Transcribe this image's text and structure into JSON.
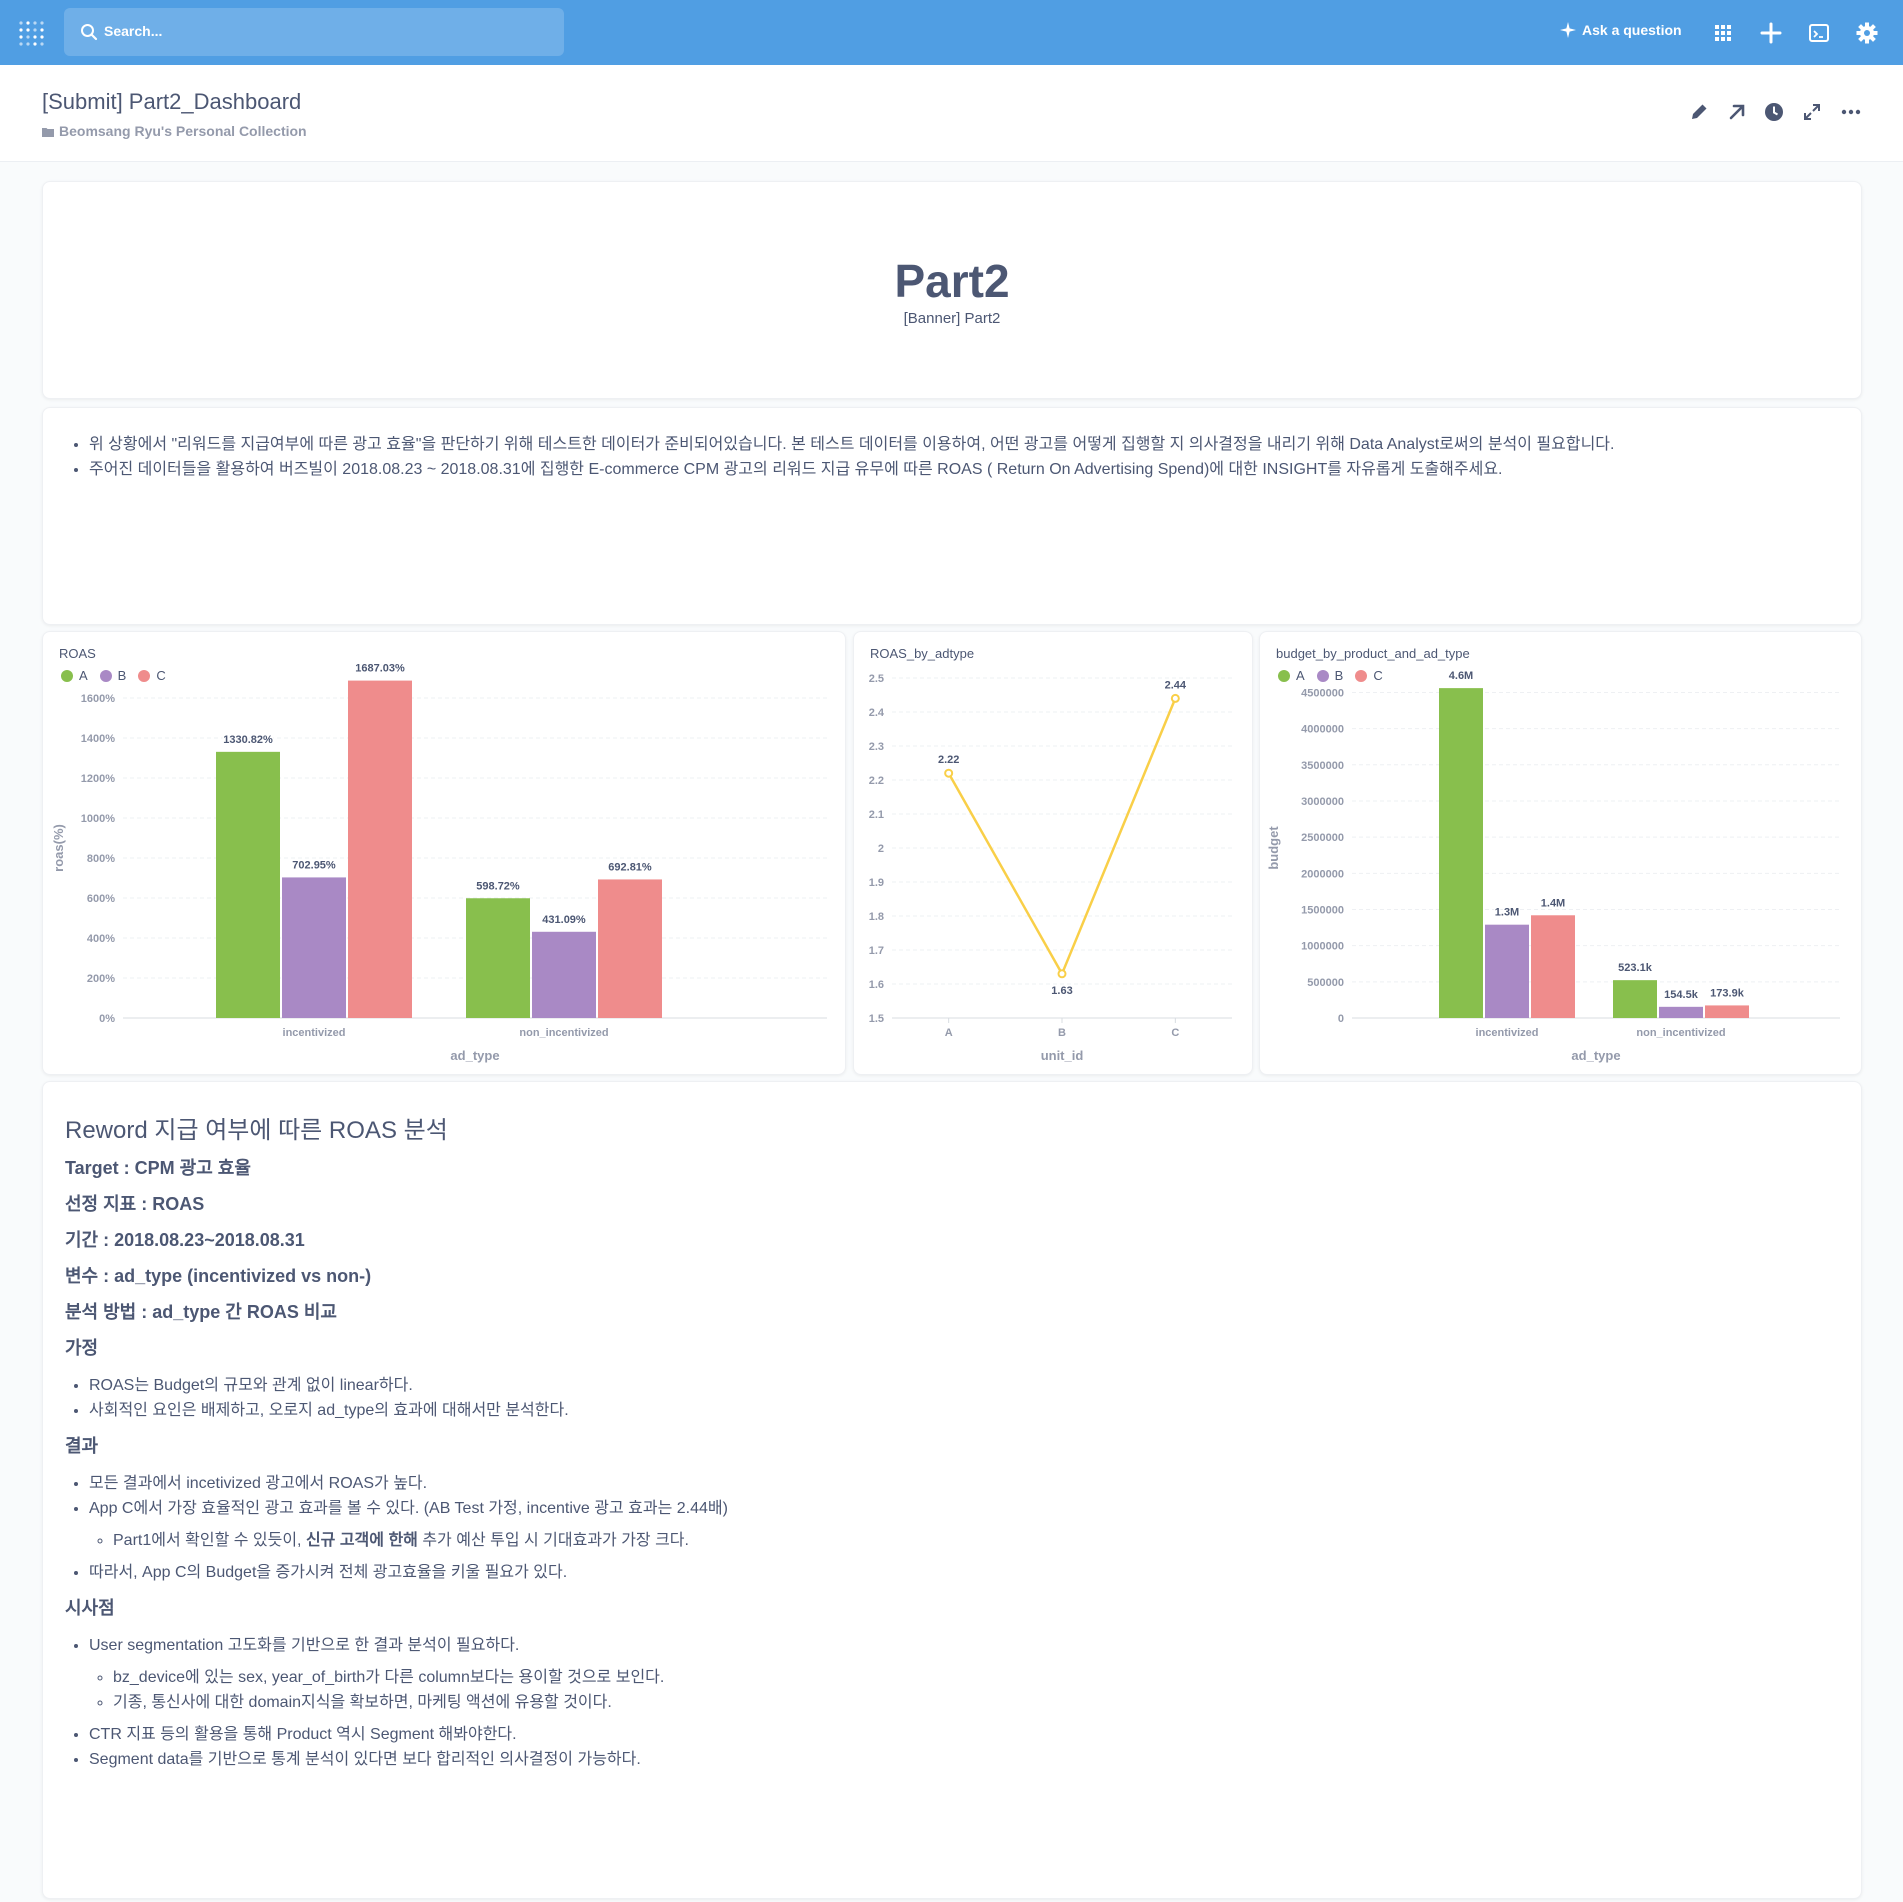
{
  "nav": {
    "search_placeholder": "Search...",
    "ask_label": "Ask a question",
    "icons": [
      "metabase-logo-icon",
      "search-icon",
      "sparkle-icon",
      "grid-icon",
      "plus-icon",
      "sql-editor-icon",
      "gear-icon"
    ],
    "bg_color": "#509ee3"
  },
  "header": {
    "title": "[Submit] Part2_Dashboard",
    "collection": "Beomsang Ryu's Personal Collection"
  },
  "banner": {
    "title": "Part2",
    "subtitle": "[Banner] Part2"
  },
  "intro": {
    "bullets": [
      "위 상황에서 \"리워드를 지급여부에 따른 광고 효율\"을 판단하기 위해 테스트한 데이터가 준비되어있습니다. 본 테스트 데이터를 이용하여, 어떤 광고를 어떻게 집행할 지 의사결정을 내리기 위해 Data Analyst로써의 분석이 필요합니다.",
      "주어진 데이터들을 활용하여 버즈빌이 2018.08.23 ~ 2018.08.31에 집행한 E-commerce CPM 광고의 리워드 지급 유무에 따른 ROAS ( Return On Advertising Spend)에 대한 INSIGHT를 자유롭게 도출해주세요."
    ]
  },
  "colors": {
    "A": "#88bf4d",
    "B": "#a989c5",
    "C": "#ef8c8c",
    "line": "#f9cf48"
  },
  "chart_data": [
    {
      "type": "bar",
      "title": "ROAS",
      "categories": [
        "incentivized",
        "non_incentivized"
      ],
      "series": [
        {
          "name": "A",
          "values": [
            1330.82,
            598.72
          ],
          "labels": [
            "1330.82%",
            "598.72%"
          ]
        },
        {
          "name": "B",
          "values": [
            702.95,
            431.09
          ],
          "labels": [
            "702.95%",
            "431.09%"
          ]
        },
        {
          "name": "C",
          "values": [
            1687.03,
            692.81
          ],
          "labels": [
            "1687.03%",
            "692.81%"
          ]
        }
      ],
      "xlabel": "ad_type",
      "ylabel": "roas(%)",
      "ylim": [
        0,
        1700
      ],
      "yticks": [
        0,
        200,
        400,
        600,
        800,
        1000,
        1200,
        1400,
        1600
      ],
      "ytick_labels": [
        "0%",
        "200%",
        "400%",
        "600%",
        "800%",
        "1000%",
        "1200%",
        "1400%",
        "1600%"
      ],
      "legend": "top-left",
      "grid": true
    },
    {
      "type": "line",
      "title": "ROAS_by_adtype",
      "x": [
        "A",
        "B",
        "C"
      ],
      "y": [
        2.22,
        1.63,
        2.44
      ],
      "labels": [
        "2.22",
        "1.63",
        "2.44"
      ],
      "xlabel": "unit_id",
      "ylabel": "",
      "ylim": [
        1.5,
        2.5
      ],
      "yticks": [
        1.5,
        1.6,
        1.7,
        1.8,
        1.9,
        2,
        2.1,
        2.2,
        2.3,
        2.4,
        2.5
      ],
      "ytick_labels": [
        "1.5",
        "1.6",
        "1.7",
        "1.8",
        "1.9",
        "2",
        "2.1",
        "2.2",
        "2.3",
        "2.4",
        "2.5"
      ],
      "grid": true
    },
    {
      "type": "bar",
      "title": "budget_by_product_and_ad_type",
      "categories": [
        "incentivized",
        "non_incentivized"
      ],
      "series": [
        {
          "name": "A",
          "values": [
            4560000,
            523100
          ],
          "labels": [
            "4.6M",
            "523.1k"
          ]
        },
        {
          "name": "B",
          "values": [
            1290000,
            154500
          ],
          "labels": [
            "1.3M",
            "154.5k"
          ]
        },
        {
          "name": "C",
          "values": [
            1420000,
            173900
          ],
          "labels": [
            "1.4M",
            "173.9k"
          ]
        }
      ],
      "xlabel": "ad_type",
      "ylabel": "budget",
      "ylim": [
        0,
        4700000
      ],
      "yticks": [
        0,
        500000,
        1000000,
        1500000,
        2000000,
        2500000,
        3000000,
        3500000,
        4000000,
        4500000
      ],
      "ytick_labels": [
        "0",
        "500000",
        "1000000",
        "1500000",
        "2000000",
        "2500000",
        "3000000",
        "3500000",
        "4000000",
        "4500000"
      ],
      "legend": "top-left",
      "grid": true
    }
  ],
  "report": {
    "heading": "Reword 지급 여부에 따른 ROAS 분석",
    "target": "Target : CPM 광고 효율",
    "metric": "선정 지표 : ROAS",
    "period": "기간 : 2018.08.23~2018.08.31",
    "variable": "변수 : ad_type (incentivized vs non-)",
    "method": "분석 방법 : ad_type 간 ROAS 비교",
    "hypothesis_title": "가정",
    "hypothesis": [
      "ROAS는 Budget의 규모와 관계 없이 linear하다.",
      "사회적인 요인은 배제하고, 오로지 ad_type의 효과에 대해서만 분석한다."
    ],
    "result_title": "결과",
    "result_1": "모든 결과에서 incetivized 광고에서 ROAS가 높다.",
    "result_2": "App C에서 가장 효율적인 광고 효과를 볼 수 있다. (AB Test 가정, incentive 광고 효과는 2.44배)",
    "result_2_sub_a": "Part1에서 확인할 수 있듯이, ",
    "result_2_sub_bold": "신규 고객에 한해",
    "result_2_sub_b": " 추가 예산 투입 시 기대효과가 가장 크다.",
    "result_3": "따라서, App C의 Budget을 증가시켜 전체 광고효율을 키울 필요가 있다.",
    "implication_title": "시사점",
    "impl_1": "User segmentation 고도화를 기반으로 한 결과 분석이 필요하다.",
    "impl_1_sub": [
      "bz_device에 있는 sex, year_of_birth가 다른 column보다는 용이할 것으로 보인다.",
      "기종, 통신사에 대한 domain지식을 확보하면, 마케팅 액션에 유용할 것이다."
    ],
    "impl_2": "CTR 지표 등의 활용을 통해 Product 역시 Segment 해봐야한다.",
    "impl_3": "Segment data를 기반으로 통계 분석이 있다면 보다 합리적인 의사결정이 가능하다."
  }
}
